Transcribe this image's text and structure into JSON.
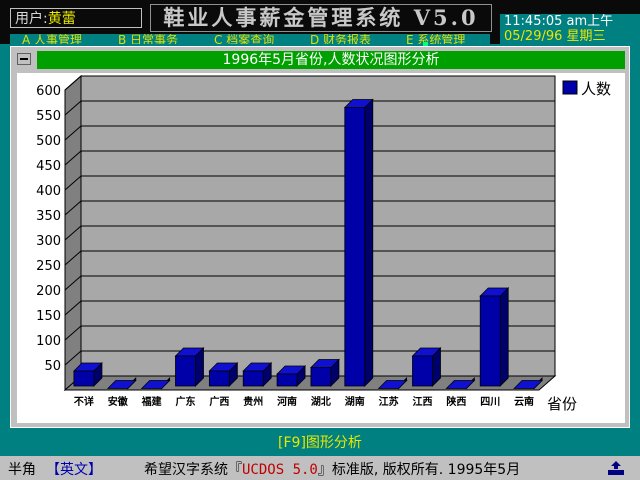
{
  "header": {
    "user_label": "用户:",
    "user_name": "黄蕾",
    "app_title": "鞋业人事薪金管理系统 V5.0",
    "time": "11:45:05 am上午",
    "date": "05/29/96 星期三"
  },
  "menu": {
    "items": [
      {
        "label": "A 人事管理"
      },
      {
        "label": "B 日常事务"
      },
      {
        "label": "C 档案查询"
      },
      {
        "label": "D 财务报表"
      },
      {
        "label": "E 系统管理"
      }
    ]
  },
  "window": {
    "title": "1996年5月省份,人数状况图形分析"
  },
  "chart_data": {
    "type": "bar",
    "categories": [
      "不详",
      "安徽",
      "福建",
      "广东",
      "广西",
      "贵州",
      "河南",
      "湖北",
      "湖南",
      "江苏",
      "江西",
      "陕西",
      "四川",
      "云南"
    ],
    "series": [
      {
        "name": "人数",
        "values": [
          38,
          3,
          3,
          68,
          38,
          38,
          32,
          45,
          565,
          3,
          68,
          3,
          188,
          3
        ],
        "color": "#0000a8"
      }
    ],
    "xlabel": "省份",
    "ylabel": "",
    "yticks": [
      50,
      100,
      150,
      200,
      250,
      300,
      350,
      400,
      450,
      500,
      550,
      600
    ],
    "ylim": [
      0,
      600
    ],
    "grid": true,
    "legend": "top-right"
  },
  "footer": {
    "hint": "[F9]图形分析"
  },
  "status": {
    "mode": "半角",
    "lang": "【英文】",
    "system_prefix": "希望汉字系统『",
    "system_name": "UCDOS 5.0",
    "system_suffix": "』标准版, 版权所有. 1995年5月"
  }
}
